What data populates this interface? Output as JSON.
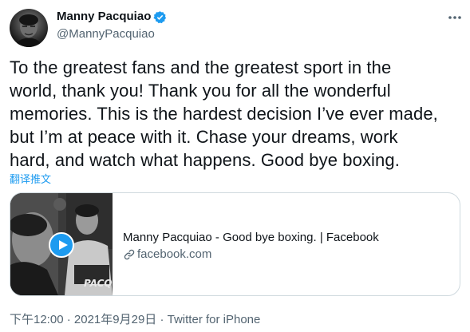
{
  "author": {
    "name": "Manny Pacquiao",
    "handle": "@MannyPacquiao",
    "verified_icon": "verified-badge-icon",
    "avatar": "profile-photo"
  },
  "tweet": {
    "text_lines": [
      "To the greatest fans and the greatest sport in the",
      "world, thank you! Thank you for all the wonderful",
      "memories. This is the hardest decision I’ve ever made,",
      "but I’m at peace with it. Chase your dreams, work",
      "hard, and watch what happens. Good bye boxing."
    ],
    "translate_label": "翻译推文"
  },
  "card": {
    "title": "Manny Pacquiao - Good bye boxing. | Facebook",
    "domain": "facebook.com",
    "thumbnail_text": "PACQ",
    "play_icon": "play-icon",
    "link_icon": "link-icon"
  },
  "meta": {
    "time": "下午12:00",
    "separator": " · ",
    "date": "2021年9月29日",
    "source": "Twitter for iPhone"
  },
  "colors": {
    "accent": "#1d9bf0",
    "text": "#0f1419",
    "secondary": "#536471",
    "border": "#cfd9de"
  }
}
